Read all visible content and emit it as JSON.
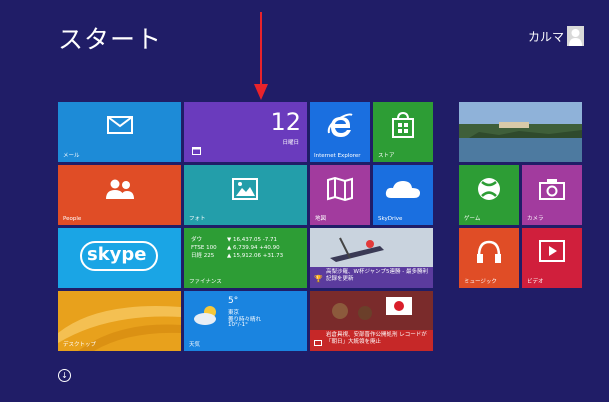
{
  "header": {
    "title": "スタート",
    "user_name": "カルマ"
  },
  "tiles": {
    "mail": {
      "label": "メール",
      "color": "#1d8bd7"
    },
    "calendar": {
      "day": "12",
      "weekday": "日曜日",
      "color": "#6a3bbd"
    },
    "ie": {
      "label": "Internet Explorer",
      "color": "#1a6fe0"
    },
    "store": {
      "label": "ストア",
      "color": "#2d9d35"
    },
    "people": {
      "label": "People",
      "color": "#e04d26"
    },
    "photos": {
      "label": "フォト",
      "color": "#239eaa"
    },
    "maps": {
      "label": "地図",
      "color": "#a23b9e"
    },
    "skydrive": {
      "label": "SkyDrive",
      "color": "#1a6fe0"
    },
    "skype": {
      "label": "skype",
      "color": "#1aa5e5"
    },
    "finance": {
      "label": "ファイナンス",
      "color": "#2d9d35",
      "rows": [
        {
          "name": "ダウ",
          "value": "▼ 16,437.05 -7.71"
        },
        {
          "name": "FTSE 100",
          "value": "▲ 6,739.94 +40.90"
        },
        {
          "name": "日経 225",
          "value": "▲ 15,912.06 +31.73"
        }
      ]
    },
    "sports": {
      "headline": "高梨沙羅、W杯ジャンプ5連勝 - 最多勝利記録を更新"
    },
    "desktop": {
      "label": "デスクトップ",
      "color": "#e8a11c"
    },
    "weather": {
      "temp": "5°",
      "city": "東京",
      "condition": "曇り時々晴れ",
      "range": "10°/-1°",
      "label": "天気",
      "color": "#1a84e0"
    },
    "news": {
      "headline": "岩倉具視、安部晋作公開処刑 レコードが「朝日」大統領を廃止"
    },
    "game": {
      "label": "ゲーム",
      "color": "#2d9d35"
    },
    "camera": {
      "label": "カメラ",
      "color": "#a23b9e"
    },
    "music": {
      "label": "ミュージック",
      "color": "#e04d26"
    },
    "video": {
      "label": "ビデオ",
      "color": "#d01f3c"
    }
  },
  "footer": {
    "all_apps_symbol": "↓"
  }
}
